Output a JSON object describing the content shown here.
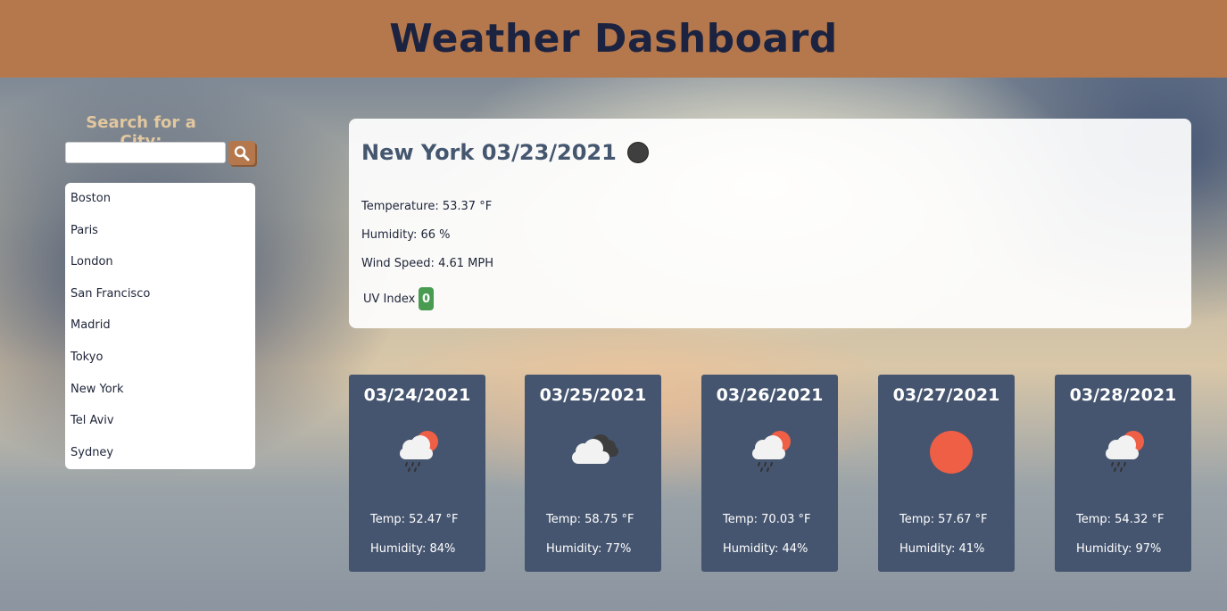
{
  "header": {
    "title": "Weather Dashboard"
  },
  "search": {
    "label": "Search for a City:",
    "value": "",
    "placeholder": ""
  },
  "cities": [
    "Boston",
    "Paris",
    "London",
    "San Francisco",
    "Madrid",
    "Tokyo",
    "New York",
    "Tel Aviv",
    "Sydney"
  ],
  "current": {
    "title": "New York 03/23/2021",
    "icon": "moon-icon",
    "temperature": "Temperature: 53.37 °F",
    "humidity": "Humidity: 66 %",
    "wind": "Wind Speed: 4.61 MPH",
    "uv_label": "UV Index :",
    "uv_value": "0",
    "uv_color": "#4a9b52"
  },
  "forecast": [
    {
      "date": "03/24/2021",
      "icon": "sun-cloud-rain-icon",
      "temp": "Temp: 52.47 °F",
      "humidity": "Humidity: 84%"
    },
    {
      "date": "03/25/2021",
      "icon": "cloudy-icon",
      "temp": "Temp: 58.75 °F",
      "humidity": "Humidity: 77%"
    },
    {
      "date": "03/26/2021",
      "icon": "sun-cloud-rain-icon",
      "temp": "Temp: 70.03 °F",
      "humidity": "Humidity: 44%"
    },
    {
      "date": "03/27/2021",
      "icon": "sun-icon",
      "temp": "Temp: 57.67 °F",
      "humidity": "Humidity: 41%"
    },
    {
      "date": "03/28/2021",
      "icon": "sun-cloud-rain-icon",
      "temp": "Temp: 54.32 °F",
      "humidity": "Humidity: 97%"
    }
  ],
  "colors": {
    "header_bg": "#b5774c",
    "title": "#1b2340",
    "card_bg": "#45556f",
    "sun": "#ef5f45"
  }
}
